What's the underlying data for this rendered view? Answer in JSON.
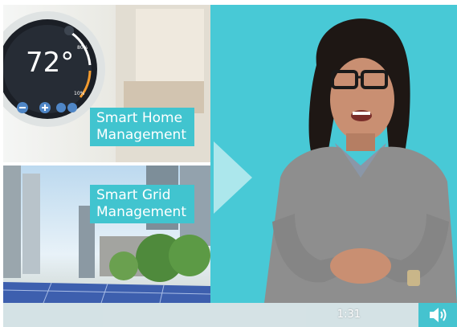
{
  "video": {
    "labels": [
      {
        "lines": [
          "Smart Home",
          "Management"
        ]
      },
      {
        "lines": [
          "Smart Grid",
          "Management"
        ]
      }
    ],
    "thermostat": {
      "temperature": "72°",
      "scale_marks": [
        "80%",
        "10%"
      ]
    },
    "control_bar": {
      "current_time": "1:31"
    },
    "colors": {
      "accent": "#48c9d6",
      "label_bg": "#41c4cf",
      "bar_bg": "#e1e4e6"
    },
    "icons": {
      "play": "play-icon",
      "volume": "speaker-icon"
    }
  }
}
